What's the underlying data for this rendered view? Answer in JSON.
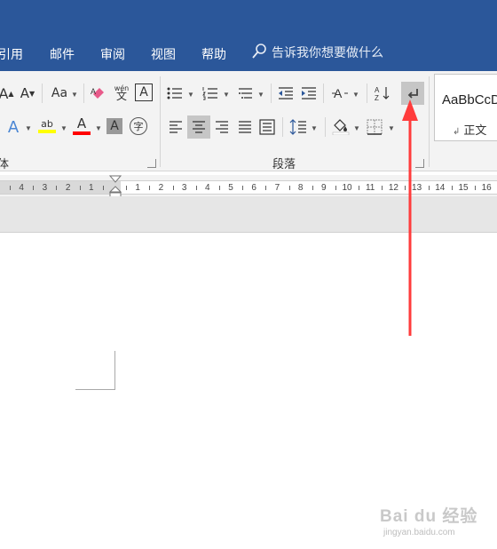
{
  "menu": {
    "items": [
      "引用",
      "邮件",
      "审阅",
      "视图",
      "帮助"
    ],
    "tell_me": "告诉我你想要做什么"
  },
  "ribbon": {
    "font_group_label": "体",
    "paragraph_group_label": "段落",
    "font_size_increase": "A",
    "font_size_decrease": "A",
    "change_case": "Aa",
    "phonetic_top": "wén",
    "phonetic_bottom": "文",
    "char_border": "A",
    "text_effects": "A",
    "highlight": "ab",
    "font_color": "A",
    "char_shading": "A",
    "enclose_char": "字"
  },
  "styles": {
    "preview": "AaBbCcD",
    "name": "正文",
    "name_mark": "↲"
  },
  "ruler": {
    "left_numbers": [
      "4",
      "3",
      "2",
      "1"
    ],
    "right_numbers": [
      "1",
      "2",
      "3",
      "4",
      "5",
      "6",
      "7",
      "8",
      "9",
      "10",
      "11",
      "12",
      "13",
      "14",
      "15",
      "16"
    ]
  },
  "watermark": {
    "brand": "Bai du 经验",
    "url": "jingyan.baidu.com"
  },
  "colors": {
    "title_bar": "#2b579a",
    "ribbon_bg": "#f3f3f3",
    "annotation_arrow": "#ff3b3b",
    "font_color_bar": "#ff0000",
    "highlight_bar": "#ffff00"
  }
}
